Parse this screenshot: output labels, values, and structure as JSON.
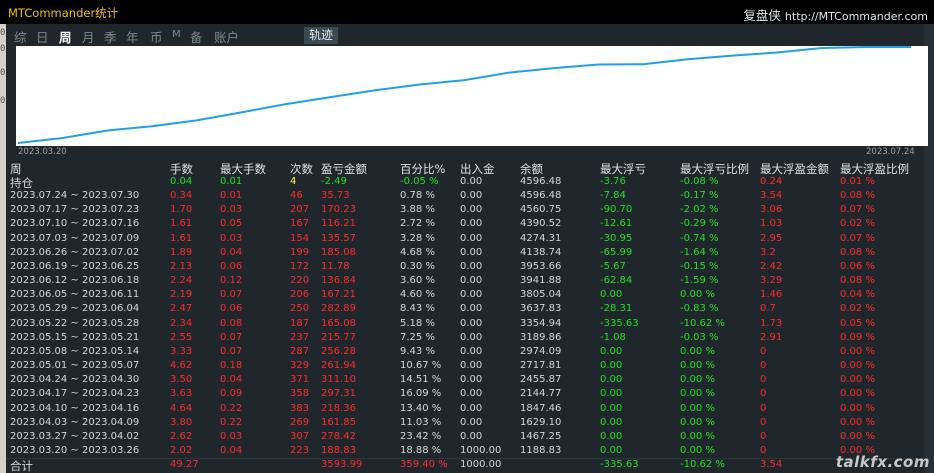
{
  "window": {
    "title": "MTCommander统计",
    "brand_cn": "复盘侠",
    "brand_url": "http://MTCommander.com"
  },
  "left_strip_chars": [
    "0",
    "0",
    "0",
    "",
    "0"
  ],
  "tabs": [
    {
      "label": "综",
      "active": false
    },
    {
      "label": "日",
      "active": false
    },
    {
      "label": "周",
      "active": true
    },
    {
      "label": "月",
      "active": false
    },
    {
      "label": "季",
      "active": false
    },
    {
      "label": "年",
      "active": false
    },
    {
      "label": "币",
      "active": false
    },
    {
      "label": "M",
      "active": false
    },
    {
      "label": "备",
      "active": false
    },
    {
      "label": "账户",
      "active": false
    }
  ],
  "track_button": "轨迹",
  "chart": {
    "start_label": "2023.03.20",
    "end_label": "2023.07.24",
    "line_color": "#1ea0e6",
    "balance_series": [
      1000.0,
      1188.83,
      1467.25,
      1629.1,
      1847.46,
      2144.77,
      2455.87,
      2717.81,
      2974.09,
      3189.86,
      3354.94,
      3637.83,
      3805.04,
      3941.88,
      3953.66,
      4138.74,
      4274.31,
      4390.52,
      4560.75,
      4596.48,
      4596.48
    ]
  },
  "table": {
    "headers": [
      "周",
      "手数",
      "最大手数",
      "次数",
      "盈亏金额",
      "百分比%",
      "出入金",
      "余额",
      "最大浮亏",
      "最大浮亏比例",
      "最大浮盈金额",
      "最大浮盈比例"
    ],
    "open_row": {
      "label": "持仓",
      "cells": [
        "0.04",
        "0.01",
        "4",
        "-2.49",
        "-0.05 %",
        "0.00",
        "4596.48",
        "-3.76",
        "-0.08 %",
        "0.24",
        "0.01 %"
      ],
      "colors": [
        "g",
        "g",
        "y",
        "g",
        "g",
        "w",
        "w",
        "g",
        "g",
        "r",
        "r"
      ]
    },
    "rows": [
      {
        "label": "2023.07.24 ~ 2023.07.30",
        "cells": [
          "0.34",
          "0.01",
          "46",
          "35.73",
          "0.78 %",
          "0.00",
          "4596.48",
          "-7.84",
          "-0.17 %",
          "3.54",
          "0.08 %"
        ]
      },
      {
        "label": "2023.07.17 ~ 2023.07.23",
        "cells": [
          "1.70",
          "0.03",
          "207",
          "170.23",
          "3.88 %",
          "0.00",
          "4560.75",
          "-90.70",
          "-2.02 %",
          "3.06",
          "0.07 %"
        ]
      },
      {
        "label": "2023.07.10 ~ 2023.07.16",
        "cells": [
          "1.61",
          "0.05",
          "167",
          "116.21",
          "2.72 %",
          "0.00",
          "4390.52",
          "-12.61",
          "-0.29 %",
          "1.03",
          "0.02 %"
        ]
      },
      {
        "label": "2023.07.03 ~ 2023.07.09",
        "cells": [
          "1.61",
          "0.03",
          "154",
          "135.57",
          "3.28 %",
          "0.00",
          "4274.31",
          "-30.95",
          "-0.74 %",
          "2.95",
          "0.07 %"
        ]
      },
      {
        "label": "2023.06.26 ~ 2023.07.02",
        "cells": [
          "1.89",
          "0.04",
          "199",
          "185.08",
          "4.68 %",
          "0.00",
          "4138.74",
          "-65.99",
          "-1.64 %",
          "3.2",
          "0.08 %"
        ]
      },
      {
        "label": "2023.06.19 ~ 2023.06.25",
        "cells": [
          "2.13",
          "0.06",
          "172",
          "11.78",
          "0.30 %",
          "0.00",
          "3953.66",
          "-5.67",
          "-0.15 %",
          "2.42",
          "0.06 %"
        ]
      },
      {
        "label": "2023.06.12 ~ 2023.06.18",
        "cells": [
          "2.24",
          "0.12",
          "220",
          "136.84",
          "3.60 %",
          "0.00",
          "3941.88",
          "-62.84",
          "-1.59 %",
          "3.29",
          "0.08 %"
        ]
      },
      {
        "label": "2023.06.05 ~ 2023.06.11",
        "cells": [
          "2.19",
          "0.07",
          "206",
          "167.21",
          "4.60 %",
          "0.00",
          "3805.04",
          "0.00",
          "0.00 %",
          "1.46",
          "0.04 %"
        ]
      },
      {
        "label": "2023.05.29 ~ 2023.06.04",
        "cells": [
          "2.47",
          "0.06",
          "250",
          "282.89",
          "8.43 %",
          "0.00",
          "3637.83",
          "-28.31",
          "-0.83 %",
          "0.7",
          "0.02 %"
        ]
      },
      {
        "label": "2023.05.22 ~ 2023.05.28",
        "cells": [
          "2.34",
          "0.08",
          "187",
          "165.08",
          "5.18 %",
          "0.00",
          "3354.94",
          "-335.63",
          "-10.62 %",
          "1.73",
          "0.05 %"
        ]
      },
      {
        "label": "2023.05.15 ~ 2023.05.21",
        "cells": [
          "2.55",
          "0.07",
          "237",
          "215.77",
          "7.25 %",
          "0.00",
          "3189.86",
          "-1.08",
          "-0.03 %",
          "2.91",
          "0.09 %"
        ]
      },
      {
        "label": "2023.05.08 ~ 2023.05.14",
        "cells": [
          "3.33",
          "0.07",
          "287",
          "256.28",
          "9.43 %",
          "0.00",
          "2974.09",
          "0.00",
          "0.00 %",
          "0",
          "0.00 %"
        ]
      },
      {
        "label": "2023.05.01 ~ 2023.05.07",
        "cells": [
          "4.62",
          "0.18",
          "329",
          "261.94",
          "10.67 %",
          "0.00",
          "2717.81",
          "0.00",
          "0.00 %",
          "0",
          "0.00 %"
        ]
      },
      {
        "label": "2023.04.24 ~ 2023.04.30",
        "cells": [
          "3.50",
          "0.04",
          "371",
          "311.10",
          "14.51 %",
          "0.00",
          "2455.87",
          "0.00",
          "0.00 %",
          "0",
          "0.00 %"
        ]
      },
      {
        "label": "2023.04.17 ~ 2023.04.23",
        "cells": [
          "3.63",
          "0.09",
          "358",
          "297.31",
          "16.09 %",
          "0.00",
          "2144.77",
          "0.00",
          "0.00 %",
          "0",
          "0.00 %"
        ]
      },
      {
        "label": "2023.04.10 ~ 2023.04.16",
        "cells": [
          "4.64",
          "0.22",
          "383",
          "218.36",
          "13.40 %",
          "0.00",
          "1847.46",
          "0.00",
          "0.00 %",
          "0",
          "0.00 %"
        ]
      },
      {
        "label": "2023.04.03 ~ 2023.04.09",
        "cells": [
          "3.80",
          "0.22",
          "269",
          "161.85",
          "11.03 %",
          "0.00",
          "1629.10",
          "0.00",
          "0.00 %",
          "0",
          "0.00 %"
        ]
      },
      {
        "label": "2023.03.27 ~ 2023.04.02",
        "cells": [
          "2.62",
          "0.03",
          "307",
          "278.42",
          "23.42 %",
          "0.00",
          "1467.25",
          "0.00",
          "0.00 %",
          "0",
          "0.00 %"
        ]
      },
      {
        "label": "2023.03.20 ~ 2023.03.26",
        "cells": [
          "2.02",
          "0.04",
          "223",
          "188.83",
          "18.88 %",
          "1000.00",
          "1188.83",
          "0.00",
          "0.00 %",
          "0",
          "0.00 %"
        ]
      }
    ],
    "row_colors": [
      "r",
      "r",
      "r",
      "r",
      "r",
      "w",
      "w",
      "w",
      "g",
      "g",
      "r",
      "r"
    ],
    "total_row": {
      "label": "合计",
      "cells": [
        "49.27",
        "",
        "",
        "3593.99",
        "359.40 %",
        "1000.00",
        "",
        "-335.63",
        "-10.62 %",
        "3.54",
        ""
      ],
      "colors": [
        "r",
        "w",
        "w",
        "r",
        "r",
        "w",
        "w",
        "g",
        "g",
        "r",
        "w"
      ]
    }
  },
  "watermark": "talkfx.com"
}
